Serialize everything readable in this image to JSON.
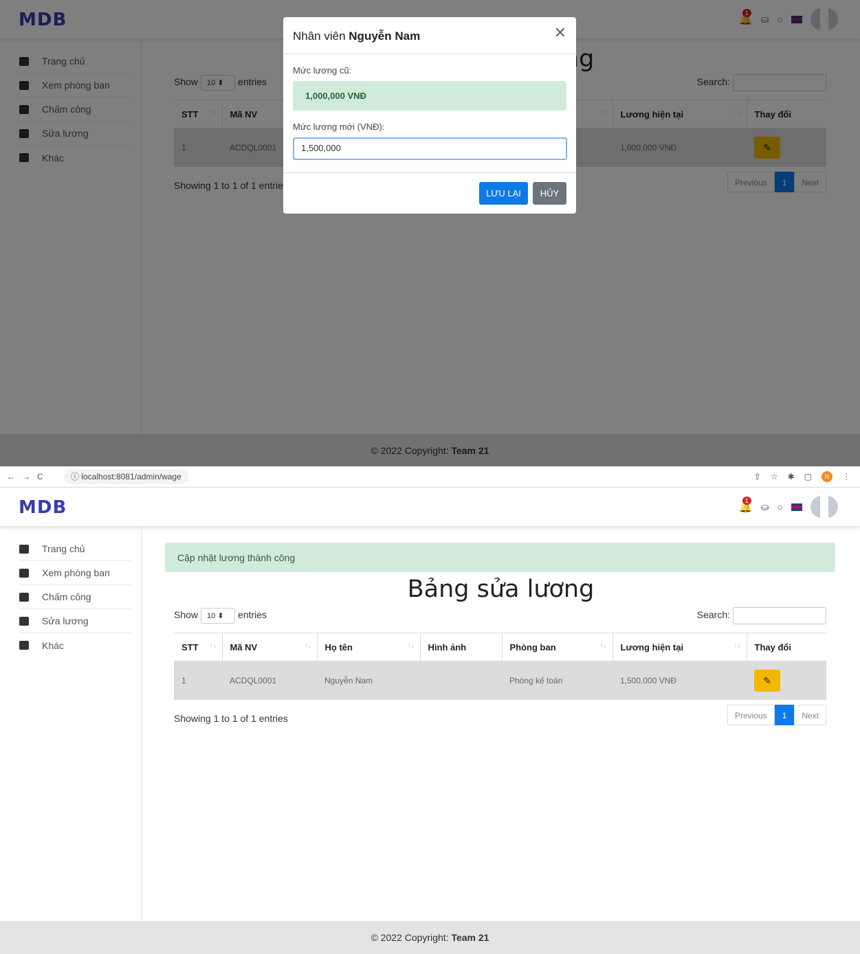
{
  "app": {
    "logo": "MDB",
    "notification_count": "1",
    "footer_prefix": "© 2022 Copyright: ",
    "footer_brand": "Team 21"
  },
  "sidebar": {
    "items": [
      {
        "label": "Trang chủ",
        "icon": "dashboard-icon"
      },
      {
        "label": "Xem phòng ban",
        "icon": "building-icon"
      },
      {
        "label": "Chấm công",
        "icon": "calendar-icon"
      },
      {
        "label": "Sửa lương",
        "icon": "money-icon"
      },
      {
        "label": "Khác",
        "icon": "grid-icon"
      }
    ]
  },
  "browser": {
    "url": "localhost:8081/admin/wage",
    "profile_initial": "N"
  },
  "modal": {
    "title_prefix": "Nhân viên ",
    "employee_name": "Nguyễn Nam",
    "old_wage_label": "Mức lương cũ:",
    "old_wage_value": "1,000,000 VNĐ",
    "new_wage_label": "Mức lương mới (VNĐ):",
    "new_wage_input": "1,500,000",
    "save_label": "LƯU LẠI",
    "cancel_label": "HỦY"
  },
  "alert": {
    "message": "Cập nhật lương thành công"
  },
  "page": {
    "title": "Bảng sửa lương",
    "show_label": "Show",
    "entries_label": "entries",
    "page_length": "10",
    "search_label": "Search:",
    "info_text": "Showing 1 to 1 of 1 entries",
    "info_text_clipped": "Showing 1 to 1 of 1 entrie",
    "prev_label": "Previous",
    "next_label": "Next",
    "current_page": "1"
  },
  "table": {
    "headers": [
      "STT",
      "Mã NV",
      "Họ tên",
      "Hình ảnh",
      "Phòng ban",
      "Lương hiện tại",
      "Thay đổi"
    ],
    "rows_before": [
      {
        "stt": "1",
        "ma_nv": "ACDQL0001",
        "luong": "1,000,000 VNĐ"
      }
    ],
    "rows_after": [
      {
        "stt": "1",
        "ma_nv": "ACDQL0001",
        "ho_ten": "Nguyễn Nam",
        "hinh_anh": "",
        "phong_ban": "Phòng kế toán",
        "luong": "1,500,000 VNĐ"
      }
    ]
  },
  "colors": {
    "primary": "#0d7ae8",
    "warning": "#f5b800",
    "success_bg": "#d1ebdb",
    "secondary": "#6c757d"
  }
}
